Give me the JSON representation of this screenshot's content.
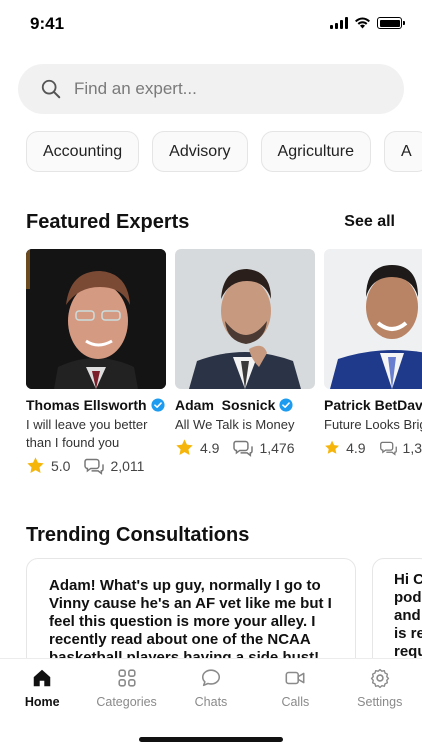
{
  "status_bar": {
    "time": "9:41"
  },
  "search": {
    "placeholder": "Find an expert..."
  },
  "categories": [
    "Accounting",
    "Advisory",
    "Agriculture",
    "A"
  ],
  "featured": {
    "title": "Featured Experts",
    "see_all": "See all",
    "experts": [
      {
        "name": "Thomas Ellsworth",
        "tagline": "I will leave you better than I found you",
        "rating": "5.0",
        "reviews": "2,011",
        "verified": true
      },
      {
        "name": "Adam  Sosnick",
        "tagline": "All We Talk is Money",
        "rating": "4.9",
        "reviews": "1,476",
        "verified": true
      },
      {
        "name": "Patrick BetDav",
        "tagline": "Future Looks Brig",
        "rating": "4.9",
        "reviews": "1,3",
        "verified": false
      }
    ]
  },
  "trending": {
    "title": "Trending Consultations",
    "cards": [
      {
        "text": "Adam! What's up guy, normally I go to Vinny cause he's an AF vet like me but I feel this question is more your alley. I recently read about one of the NCAA basketball players having a side hust!"
      },
      {
        "text": "Hi C pod and is re requ"
      }
    ]
  },
  "tab_bar": {
    "tabs": [
      {
        "label": "Home",
        "icon": "home-icon",
        "active": true
      },
      {
        "label": "Categories",
        "icon": "grid-icon",
        "active": false
      },
      {
        "label": "Chats",
        "icon": "chat-bubble-icon",
        "active": false
      },
      {
        "label": "Calls",
        "icon": "video-camera-icon",
        "active": false
      },
      {
        "label": "Settings",
        "icon": "gear-icon",
        "active": false
      }
    ]
  },
  "colors": {
    "verified_blue": "#1d9bf0",
    "star": "#f5b50a",
    "search_bg": "#f1f1f1"
  }
}
